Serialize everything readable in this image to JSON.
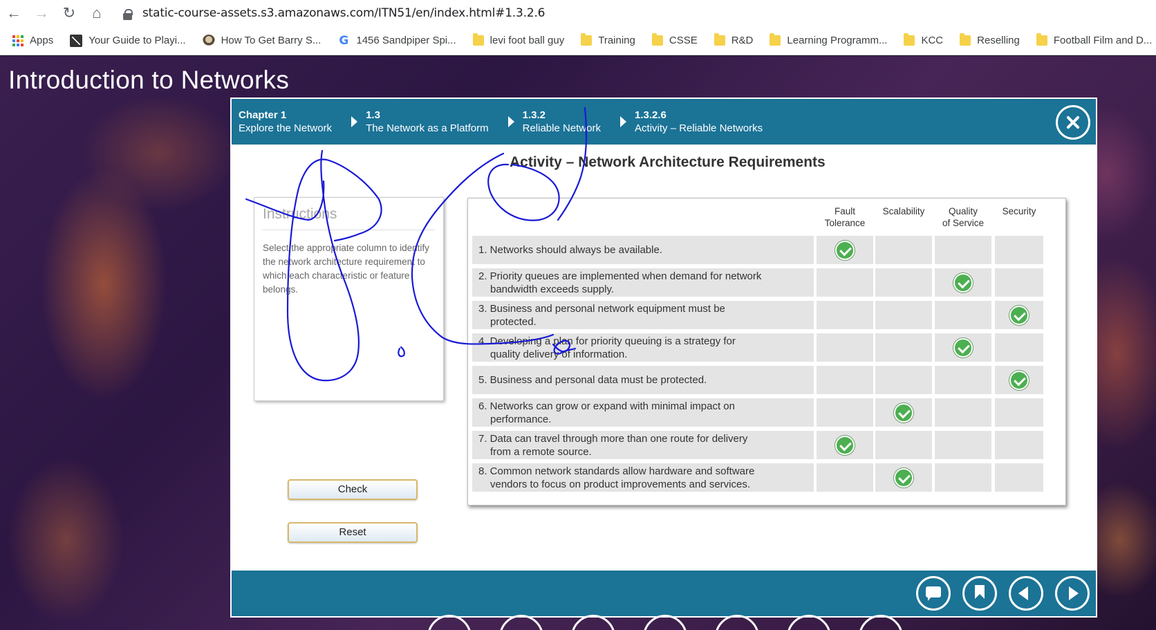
{
  "browser": {
    "url": "static-course-assets.s3.amazonaws.com/ITN51/en/index.html#1.3.2.6",
    "bookmarks": [
      {
        "label": "Apps",
        "icon": "apps-grid-icon"
      },
      {
        "label": "Your Guide to Playi...",
        "icon": "guide-icon"
      },
      {
        "label": "How To Get Barry S...",
        "icon": "barry-icon"
      },
      {
        "label": "1456 Sandpiper Spi...",
        "icon": "google-icon"
      },
      {
        "label": "levi foot ball guy",
        "icon": "folder-icon"
      },
      {
        "label": "Training",
        "icon": "folder-icon"
      },
      {
        "label": "CSSE",
        "icon": "folder-icon"
      },
      {
        "label": "R&D",
        "icon": "folder-icon"
      },
      {
        "label": "Learning Programm...",
        "icon": "folder-icon"
      },
      {
        "label": "KCC",
        "icon": "folder-icon"
      },
      {
        "label": "Reselling",
        "icon": "folder-icon"
      },
      {
        "label": "Football Film and D...",
        "icon": "folder-icon"
      }
    ]
  },
  "course": {
    "title": "Introduction to Networks"
  },
  "breadcrumbs": [
    {
      "id": "Chapter 1",
      "label": "Explore the Network"
    },
    {
      "id": "1.3",
      "label": "The Network as a Platform"
    },
    {
      "id": "1.3.2",
      "label": "Reliable Network"
    },
    {
      "id": "1.3.2.6",
      "label": "Activity – Reliable Networks"
    }
  ],
  "activity": {
    "title": "Activity – Network Architecture Requirements",
    "instructions_heading": "Instructions",
    "instructions_text": "Select the appropriate column to identify the network architecture requirement to which each characteristic or feature belongs.",
    "check_label": "Check",
    "reset_label": "Reset",
    "columns": [
      "Fault Tolerance",
      "Scalability",
      "Quality of Service",
      "Security"
    ],
    "column_lines": [
      [
        "Fault",
        "Tolerance"
      ],
      [
        "Scalability"
      ],
      [
        "Quality",
        "of Service"
      ],
      [
        "Security"
      ]
    ],
    "rows": [
      {
        "line1": "1. Networks should always be available.",
        "line2": "",
        "checked": "Fault Tolerance"
      },
      {
        "line1": "2. Priority queues are implemented when demand for network",
        "line2": "bandwidth exceeds supply.",
        "checked": "Quality of Service"
      },
      {
        "line1": "3. Business and personal network equipment must be",
        "line2": "protected.",
        "checked": "Security"
      },
      {
        "line1": "4. Developing a plan for priority queuing is a strategy for",
        "line2": "quality delivery of information.",
        "checked": "Quality of Service"
      },
      {
        "line1": "5. Business and personal data must be protected.",
        "line2": "",
        "checked": "Security"
      },
      {
        "line1": "6. Networks can grow or expand with minimal impact on",
        "line2": "performance.",
        "checked": "Scalability"
      },
      {
        "line1": "7. Data can travel through more than one route for delivery",
        "line2": "from a remote source.",
        "checked": "Fault Tolerance"
      },
      {
        "line1": "8. Common network standards allow hardware and software",
        "line2": "vendors to focus on product improvements and services.",
        "checked": "Scalability"
      }
    ]
  },
  "footer_buttons": [
    "comment-icon",
    "bookmark-icon",
    "previous-icon",
    "next-icon"
  ],
  "colors": {
    "header_blue": "#1b7396",
    "check_green": "#4caf50",
    "cell_gray": "#e4e4e4",
    "ink_blue": "#1a1ad6"
  }
}
